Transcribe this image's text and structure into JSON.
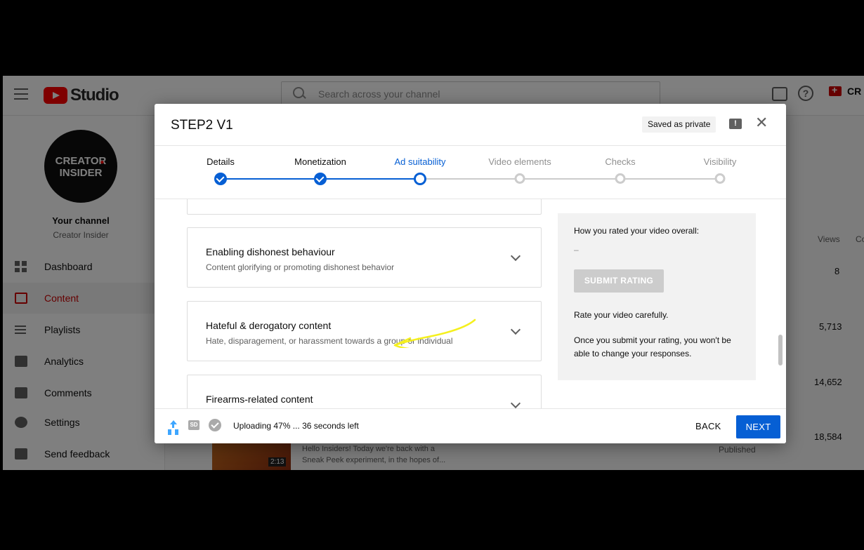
{
  "app": {
    "logo_text": "Studio",
    "search_placeholder": "Search across your channel",
    "create_label": "CR"
  },
  "sidebar": {
    "avatar_line1": "CREATOR",
    "avatar_line2": "INSIDER",
    "channel_title": "Your channel",
    "channel_name": "Creator Insider",
    "items": [
      {
        "label": "Dashboard",
        "icon": "dashboard-icon"
      },
      {
        "label": "Content",
        "icon": "content-icon"
      },
      {
        "label": "Playlists",
        "icon": "playlists-icon"
      },
      {
        "label": "Analytics",
        "icon": "analytics-icon"
      },
      {
        "label": "Comments",
        "icon": "comments-icon"
      },
      {
        "label": "Settings",
        "icon": "settings-icon"
      },
      {
        "label": "Send feedback",
        "icon": "feedback-icon"
      }
    ]
  },
  "background_table": {
    "views_header": "Views",
    "col2_header": "Co",
    "values": [
      "8",
      "5,713",
      "14,652",
      "18,584"
    ],
    "status": "Published",
    "video_duration": "2:13",
    "video_desc": "Hello Insiders! Today we're back with a Sneak Peek experiment, in the hopes of..."
  },
  "dialog": {
    "title": "STEP2 V1",
    "saved_badge": "Saved as private",
    "steps": [
      {
        "label": "Details",
        "state": "done"
      },
      {
        "label": "Monetization",
        "state": "done"
      },
      {
        "label": "Ad suitability",
        "state": "current"
      },
      {
        "label": "Video elements",
        "state": "todo"
      },
      {
        "label": "Checks",
        "state": "todo"
      },
      {
        "label": "Visibility",
        "state": "todo"
      }
    ],
    "categories": [
      {
        "title": "Enabling dishonest behaviour",
        "desc": "Content glorifying or promoting dishonest behavior"
      },
      {
        "title": "Hateful & derogatory content",
        "desc": "Hate, disparagement, or harassment towards a group or individual"
      },
      {
        "title": "Firearms-related content",
        "desc": ""
      }
    ],
    "panel": {
      "heading": "How you rated your video overall:",
      "rating": "–",
      "submit_label": "SUBMIT RATING",
      "hint": "Rate your video carefully.",
      "warning": "Once you submit your rating, you won't be able to change your responses."
    },
    "footer": {
      "sd_badge": "SD",
      "status": "Uploading 47% ... 36 seconds left",
      "upload_progress_percent": 47,
      "back_label": "BACK",
      "next_label": "NEXT"
    }
  },
  "colors": {
    "accent": "#065fd4",
    "brand_red": "#ff0000",
    "annotation": "#f5f01e"
  }
}
